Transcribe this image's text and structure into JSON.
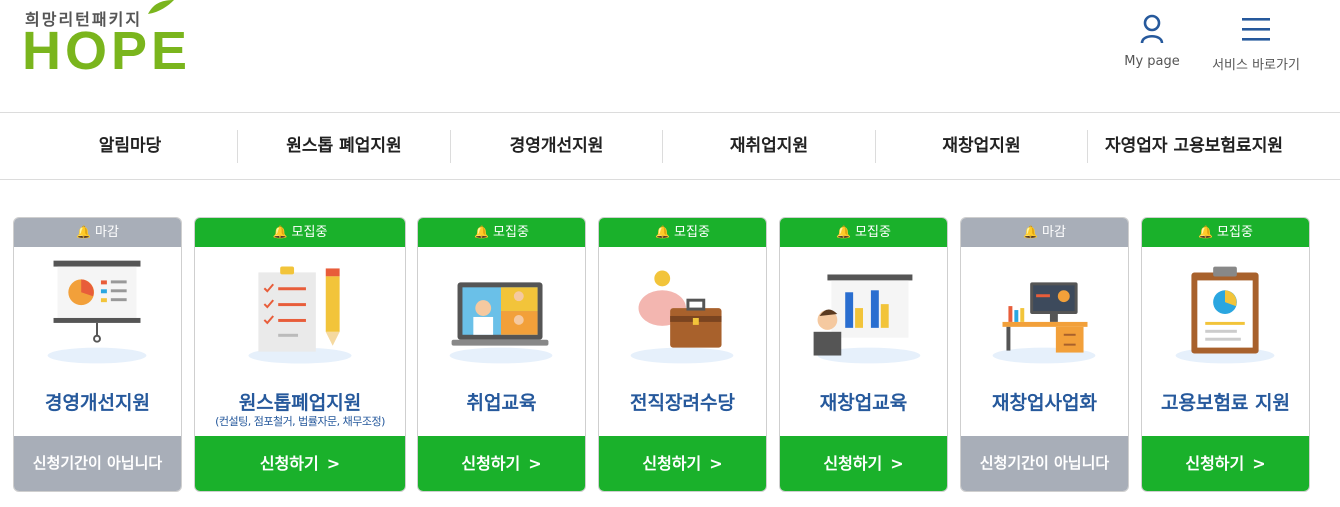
{
  "header": {
    "logo_sub": "희망리턴패키지",
    "logo_main": "HOPE",
    "mypage_label": "My page",
    "service_label": "서비스 바로가기"
  },
  "nav": {
    "items": [
      {
        "label": "알림마당"
      },
      {
        "label": "원스톱 폐업지원"
      },
      {
        "label": "경영개선지원"
      },
      {
        "label": "재취업지원"
      },
      {
        "label": "재창업지원"
      },
      {
        "label": "자영업자 고용보험료지원"
      }
    ]
  },
  "colors": {
    "open": "#1ab12b",
    "closed": "#a8aeb8",
    "title": "#26599c",
    "logo": "#7ab51d"
  },
  "cards": [
    {
      "status": "마감",
      "title": "경영개선지원",
      "subtitle": "",
      "cta": "신청기간이 아닙니다",
      "icon": "presentation-board-icon"
    },
    {
      "status": "모집중",
      "title": "원스톱폐업지원",
      "subtitle": "(컨설팅, 점포철거, 법률자문, 채무조정)",
      "cta": "신청하기",
      "icon": "checklist-pencil-icon"
    },
    {
      "status": "모집중",
      "title": "취업교육",
      "subtitle": "",
      "cta": "신청하기",
      "icon": "video-conference-laptop-icon"
    },
    {
      "status": "모집중",
      "title": "전직장려수당",
      "subtitle": "",
      "cta": "신청하기",
      "icon": "piggy-bank-briefcase-icon"
    },
    {
      "status": "모집중",
      "title": "재창업교육",
      "subtitle": "",
      "cta": "신청하기",
      "icon": "presenter-chart-icon"
    },
    {
      "status": "마감",
      "title": "재창업사업화",
      "subtitle": "",
      "cta": "신청기간이 아닙니다",
      "icon": "office-desk-icon"
    },
    {
      "status": "모집중",
      "title": "고용보험료 지원",
      "subtitle": "",
      "cta": "신청하기",
      "icon": "clipboard-chart-icon"
    }
  ]
}
